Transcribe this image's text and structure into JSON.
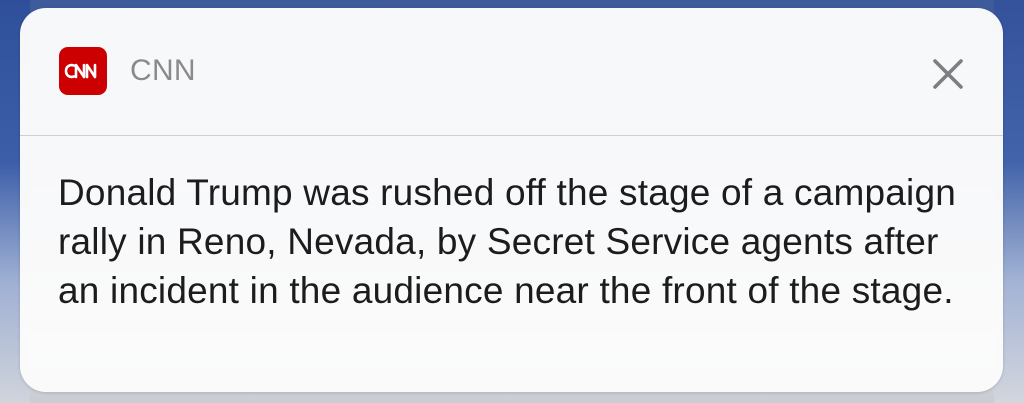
{
  "notification": {
    "app": {
      "name": "CNN",
      "icon": "cnn-logo",
      "icon_text": "CNN",
      "icon_color": "#cc0000"
    },
    "close_icon": "close-icon",
    "message": "Donald Trump was rushed off the stage of a campaign rally in Reno, Nevada, by Secret Service agents after an incident in the audience near the front of the stage."
  }
}
